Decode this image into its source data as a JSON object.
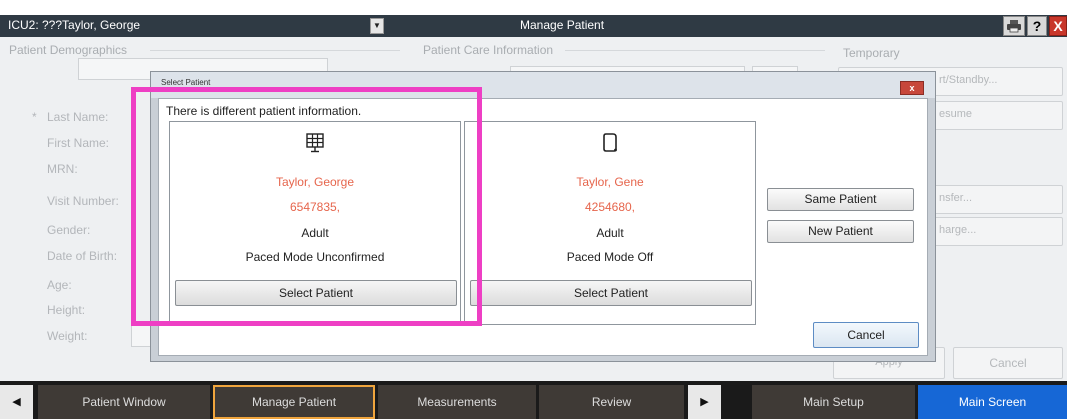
{
  "header": {
    "patient_selector": "ICU2: ???Taylor, George",
    "title": "Manage Patient",
    "help_label": "?",
    "close_label": "X"
  },
  "background": {
    "demographics_title": "Patient Demographics",
    "care_title": "Patient Care Information",
    "temporary_title": "Temporary",
    "field_labels": [
      "Last Name:",
      "First Name:",
      "MRN:",
      "Visit Number:",
      "Gender:",
      "Date of Birth:",
      "Age:",
      "Height:",
      "Weight:"
    ],
    "required_marker": "*",
    "right_buttons": [
      "rt/Standby...",
      "esume",
      "nsfer...",
      "harge..."
    ],
    "apply_label": "Apply",
    "cancel_label": "Cancel"
  },
  "modal": {
    "title": "Select Patient",
    "message": "There is different patient information.",
    "close_label": "x",
    "cards": [
      {
        "name": "Taylor, George",
        "mrn": "6547835,",
        "type": "Adult",
        "paced": "Paced Mode Unconfirmed",
        "button": "Select Patient",
        "icon": "monitor-grid-icon"
      },
      {
        "name": "Taylor, Gene",
        "mrn": "4254680,",
        "type": "Adult",
        "paced": "Paced Mode Off",
        "button": "Select Patient",
        "icon": "monitor-device-icon"
      }
    ],
    "same_patient": "Same Patient",
    "new_patient": "New Patient",
    "cancel": "Cancel"
  },
  "nav": {
    "patient_window": "Patient Window",
    "manage_patient": "Manage Patient",
    "measurements": "Measurements",
    "review": "Review",
    "main_setup": "Main Setup",
    "main_screen": "Main Screen"
  },
  "colors": {
    "header_dark": "#2f3a44",
    "patient_name": "#e6654c",
    "highlight": "#ee3fc4",
    "active_tab_border": "#f0a53d",
    "main_screen_blue": "#1667d6"
  }
}
